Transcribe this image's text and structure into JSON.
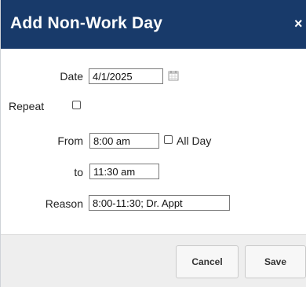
{
  "dialog": {
    "title": "Add Non-Work Day",
    "close_glyph": "×"
  },
  "form": {
    "date_label": "Date",
    "date_value": "4/1/2025",
    "repeat_label": "Repeat",
    "repeat_checked": false,
    "from_label": "From",
    "from_value": "8:00 am",
    "all_day_label": "All Day",
    "all_day_checked": false,
    "to_label": "to",
    "to_value": "11:30 am",
    "reason_label": "Reason",
    "reason_value": "8:00-11:30; Dr. Appt"
  },
  "footer": {
    "cancel_label": "Cancel",
    "save_label": "Save"
  },
  "icons": {
    "calendar": "calendar-icon",
    "close": "close-icon"
  },
  "colors": {
    "titlebar": "#183a6a",
    "footer": "#eeeeee"
  }
}
